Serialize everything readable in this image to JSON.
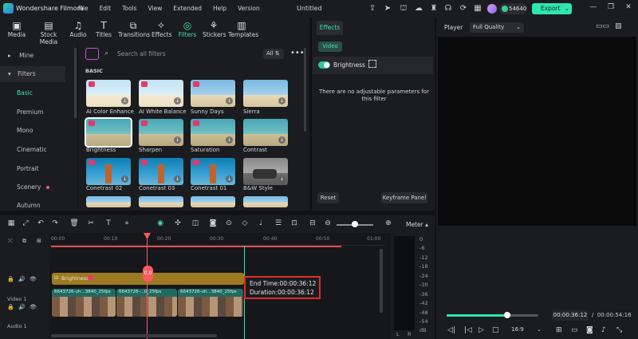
{
  "titlebar": {
    "app_name": "Wondershare Filmora",
    "menus": [
      "File",
      "Edit",
      "Tools",
      "View",
      "Extended",
      "Help",
      "Version"
    ],
    "doc_title": "Untitled",
    "credits": "54640",
    "export_label": "Export"
  },
  "toolbar": {
    "items": [
      {
        "label": "Media",
        "icon": "media-icon"
      },
      {
        "label": "Stock Media",
        "icon": "stock-media-icon"
      },
      {
        "label": "Audio",
        "icon": "music-note-icon"
      },
      {
        "label": "Titles",
        "icon": "titles-icon"
      },
      {
        "label": "Transitions",
        "icon": "transitions-icon"
      },
      {
        "label": "Effects",
        "icon": "effects-icon"
      },
      {
        "label": "Filters",
        "icon": "filters-icon"
      },
      {
        "label": "Stickers",
        "icon": "stickers-icon"
      },
      {
        "label": "Templates",
        "icon": "templates-icon"
      }
    ],
    "active": "Filters"
  },
  "library": {
    "mine": "Mine",
    "filters": "Filters",
    "categories": [
      "Basic",
      "Premium",
      "Mono",
      "Cinematic",
      "Portrait",
      "Scenery",
      "Autumn"
    ],
    "selected": "Basic"
  },
  "filters_panel": {
    "search_placeholder": "Search all filters",
    "all_label": "All",
    "more": "•••",
    "section": "BASIC",
    "items": [
      "AI Color Enhance",
      "AI White Balance",
      "Sunny Days",
      "Sierra",
      "Brightness",
      "Sharpen",
      "Saturation",
      "Contrast",
      "Conetrast 02",
      "Conetrast 03",
      "Conetrast 01",
      "B&W Style"
    ],
    "selected": "Brightness"
  },
  "effects_panel": {
    "tab": "Effects",
    "subtab": "Video",
    "effect_name": "Brightness",
    "message": "There are no adjustable parameters for this filter",
    "reset": "Reset",
    "keyframe": "Keyframe Panel"
  },
  "player": {
    "label": "Player",
    "quality": "Full Quality",
    "current_time": "00:00:36:12",
    "separator": "/",
    "total_time": "00:00:54:16",
    "progress": 0.66,
    "ratio": "16:9"
  },
  "timeline": {
    "meter_label": "Meter",
    "ruler": [
      "00:00",
      "00:10",
      "00:20",
      "00:30",
      "00:40",
      "00:50",
      "01:00"
    ],
    "filter_clip_label": "Brightness",
    "marker_label": "0.0",
    "video_track_label": "Video 1",
    "audio_track_label": "Audio 1",
    "video_clips": [
      "6643726-uh...3840_25fps",
      "6643726-...0_25fps",
      "6643726-uh...3840_25fps"
    ],
    "tooltip": {
      "end_time": "End Time:00:00:36:12",
      "duration": "Duration:00:00:36:12"
    },
    "meter_scale": [
      "0",
      "-6",
      "-12",
      "-18",
      "-24",
      "-30",
      "-36",
      "-42",
      "-48",
      "-54",
      "dB"
    ],
    "meter_channels": [
      "L",
      "R"
    ]
  }
}
